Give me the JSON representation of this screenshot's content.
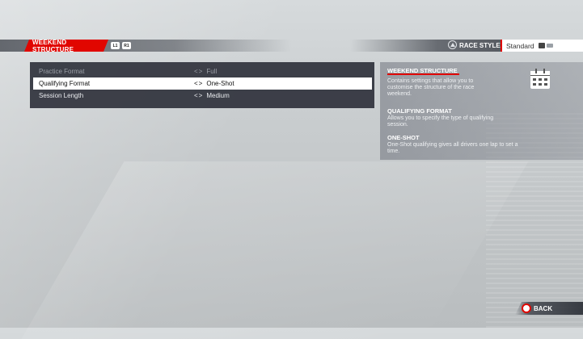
{
  "header": {
    "section_title": "WEEKEND STRUCTURE",
    "l1_label": "L1",
    "r1_label": "R1",
    "race_style_label": "RACE STYLE",
    "race_style_value": "Standard"
  },
  "settings": [
    {
      "label": "Practice Format",
      "value": "Full"
    },
    {
      "label": "Qualifying Format",
      "value": "One-Shot"
    },
    {
      "label": "Session Length",
      "value": "Medium"
    }
  ],
  "info": {
    "section_heading": "WEEKEND STRUCTURE",
    "section_text_1": "Contains settings that allow you to",
    "section_text_2": "customise the structure of the race",
    "section_text_3": "weekend.",
    "option_heading": "QUALIFYING FORMAT",
    "option_text_1": "Allows you to specify the type of qualifying",
    "option_text_2": "session.",
    "value_heading": "ONE-SHOT",
    "value_text_1": "One-Shot qualifying gives all drivers one lap to set a",
    "value_text_2": "time."
  },
  "footer": {
    "back_label": "BACK"
  },
  "arrows": "<>",
  "colors": {
    "accent_red": "#e10600",
    "panel_dark": "#282a34",
    "selected_row": "#ffffff"
  },
  "icons": {
    "triangle_button": "triangle-button-icon",
    "circle_button": "circle-button-icon",
    "options_button": "options-button-icon",
    "calendar": "calendar-icon"
  }
}
